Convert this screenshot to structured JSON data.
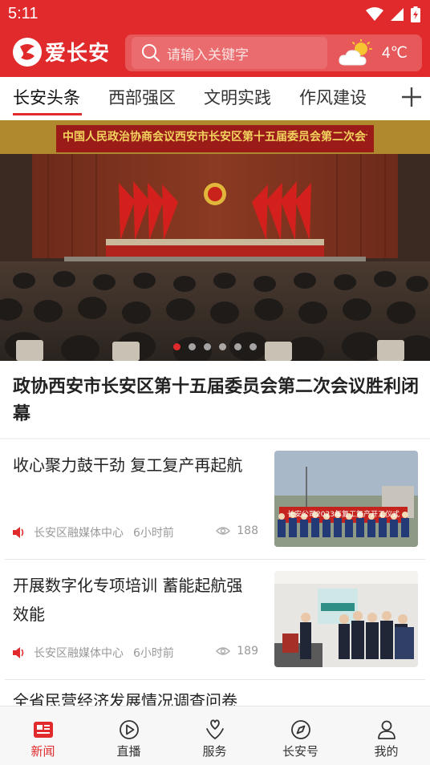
{
  "status_bar": {
    "time": "5:11"
  },
  "header": {
    "logo_text": "爱长安",
    "search_placeholder": "请输入关键字",
    "weather_temp": "4℃",
    "weather_icon": "partly-cloudy-icon"
  },
  "tabs": [
    {
      "label": "长安头条",
      "active": true
    },
    {
      "label": "西部强区"
    },
    {
      "label": "文明实践"
    },
    {
      "label": "作风建设"
    }
  ],
  "hero": {
    "banner_text": "中国人民政治协商会议西安市长安区第十五届委员会第二次会议",
    "title": "政协西安市长安区第十五届委员会第二次会议胜利闭幕",
    "dots": 6,
    "active_dot": 1
  },
  "news": [
    {
      "title": "收心聚力鼓干劲 复工复产再起航",
      "source": "长安区融媒体中心",
      "ago": "6小时前",
      "views": "188",
      "thumb_caption": "长安公司2023年复工复产开工仪式"
    },
    {
      "title": "开展数字化专项培训 蓄能起航强效能",
      "source": "长安区融媒体中心",
      "ago": "6小时前",
      "views": "189"
    }
  ],
  "partial_title": "全省民营经济发展情况调查问卷",
  "bottom_nav": [
    {
      "label": "新闻",
      "icon": "news-icon",
      "active": true
    },
    {
      "label": "直播",
      "icon": "play-icon"
    },
    {
      "label": "服务",
      "icon": "service-icon"
    },
    {
      "label": "长安号",
      "icon": "compass-icon"
    },
    {
      "label": "我的",
      "icon": "user-icon"
    }
  ],
  "colors": {
    "brand_red": "#e02a2c",
    "text": "#222222",
    "muted": "#999999"
  }
}
